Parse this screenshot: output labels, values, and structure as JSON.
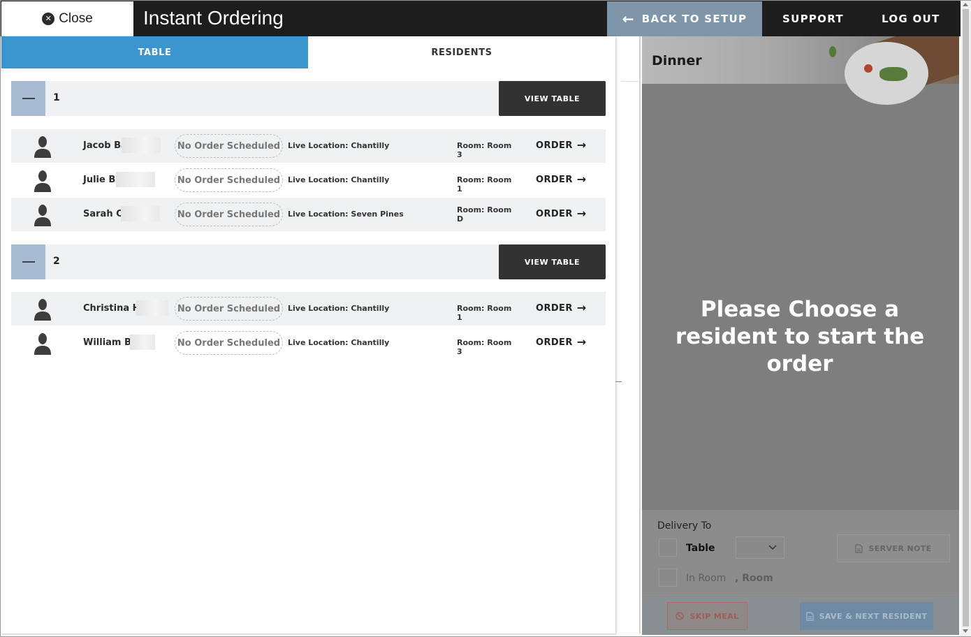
{
  "header": {
    "close_label": "Close",
    "title": "Instant Ordering",
    "back_label": "BACK TO SETUP",
    "support_label": "SUPPORT",
    "logout_label": "LOG OUT"
  },
  "tabs": [
    {
      "label": "TABLE",
      "active": true
    },
    {
      "label": "RESIDENTS",
      "active": false
    }
  ],
  "groups": [
    {
      "number": "1",
      "view_label": "VIEW TABLE",
      "residents": [
        {
          "name": "Jacob Ba",
          "status": "No Order Scheduled",
          "location": "Live Location: Chantilly",
          "room": "Room: Room 3",
          "order_label": "ORDER"
        },
        {
          "name": "Julie Bu",
          "status": "No Order Scheduled",
          "location": "Live Location: Chantilly",
          "room": "Room: Room 1",
          "order_label": "ORDER"
        },
        {
          "name": "Sarah Ca",
          "status": "No Order Scheduled",
          "location": "Live Location: Seven Pines",
          "room": "Room: Room D",
          "order_label": "ORDER"
        }
      ]
    },
    {
      "number": "2",
      "view_label": "VIEW TABLE",
      "residents": [
        {
          "name": "Christina He",
          "status": "No Order Scheduled",
          "location": "Live Location: Chantilly",
          "room": "Room: Room 1",
          "order_label": "ORDER"
        },
        {
          "name": "William Bu",
          "status": "No Order Scheduled",
          "location": "Live Location: Chantilly",
          "room": "Room: Room 3",
          "order_label": "ORDER"
        }
      ]
    }
  ],
  "order_panel": {
    "meal": "Dinner",
    "empty_message": "Please Choose a resident to start the order",
    "delivery_label": "Delivery To",
    "option_table": "Table",
    "option_in_room": "In Room",
    "room_suffix": ", Room",
    "server_note_label": "SERVER NOTE",
    "skip_label": "SKIP MEAL",
    "save_next_label": "SAVE & NEXT RESIDENT"
  },
  "icons": {
    "close": "close-circle-icon",
    "back": "arrow-left-icon",
    "order": "arrow-right-icon",
    "avatar": "person-silhouette-icon",
    "server_note": "document-icon",
    "skip": "ban-icon",
    "save_next": "document-icon",
    "select": "chevron-down-icon"
  },
  "colors": {
    "active_tab": "#3b95cf",
    "header_bg": "#1e1d1d",
    "back_button_bg": "#7f95a8",
    "collapse_bg": "#a8bbd2",
    "view_table_bg": "#333232"
  }
}
